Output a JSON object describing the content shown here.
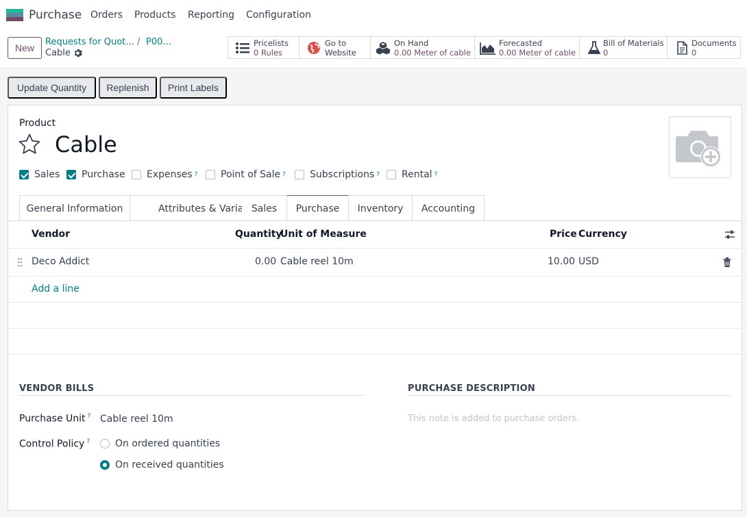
{
  "app": {
    "name": "Purchase",
    "logo_icon": "app-logo-icon"
  },
  "menu": [
    "Orders",
    "Products",
    "Reporting",
    "Configuration"
  ],
  "control_panel": {
    "new_label": "New",
    "breadcrumb": [
      "Requests for Quot…",
      "P00…"
    ],
    "breadcrumb_sep": "/",
    "current": "Cable"
  },
  "smart_buttons": [
    {
      "icon": "list-icon",
      "line1": "Pricelists",
      "line2": "0  Rules"
    },
    {
      "icon": "globe-icon",
      "line1": "Go to",
      "line2": "Website"
    },
    {
      "icon": "cubes-icon",
      "line1": "On Hand",
      "line2": "0.00 Meter of cable"
    },
    {
      "icon": "area-chart-icon",
      "line1": "Forecasted",
      "line2": "0.00 Meter of cable"
    },
    {
      "icon": "flask-icon",
      "line1": "Bill of Materials",
      "line2": "0"
    },
    {
      "icon": "document-icon",
      "line1": "Documents",
      "line2": "0"
    }
  ],
  "actions": [
    "Update Quantity",
    "Replenish",
    "Print Labels"
  ],
  "form": {
    "product_label": "Product",
    "title": "Cable",
    "checks": [
      {
        "label": "Sales",
        "checked": true,
        "help": ""
      },
      {
        "label": "Purchase",
        "checked": true,
        "help": ""
      },
      {
        "label": "Expenses",
        "checked": false,
        "help": "?"
      },
      {
        "label": "Point of Sale",
        "checked": false,
        "help": "?"
      },
      {
        "label": "Subscriptions",
        "checked": false,
        "help": "?"
      },
      {
        "label": "Rental",
        "checked": false,
        "help": "?"
      }
    ],
    "tabs": [
      "General Information",
      "Attributes & Variants",
      "Sales",
      "Purchase",
      "Inventory",
      "Accounting"
    ],
    "active_tab": "Purchase"
  },
  "vendor_table": {
    "columns": {
      "vendor": "Vendor",
      "quantity": "Quantity",
      "uom": "Unit of Measure",
      "price": "Price",
      "currency": "Currency"
    },
    "rows": [
      {
        "vendor": "Deco Addict",
        "quantity": "0.00",
        "uom": "Cable reel 10m",
        "price": "10.00",
        "currency": "USD"
      }
    ],
    "add_line": "Add a line"
  },
  "vendor_bills": {
    "title": "VENDOR BILLS",
    "purchase_unit_label": "Purchase Unit",
    "purchase_unit_value": "Cable reel 10m",
    "control_policy_label": "Control Policy",
    "help": "?",
    "options": [
      {
        "label": "On ordered quantities",
        "selected": false
      },
      {
        "label": "On received quantities",
        "selected": true
      }
    ]
  },
  "purchase_description": {
    "title": "PURCHASE DESCRIPTION",
    "placeholder": "This note is added to purchase orders."
  },
  "colors": {
    "brand": "#714b67",
    "accent": "#017e84"
  }
}
